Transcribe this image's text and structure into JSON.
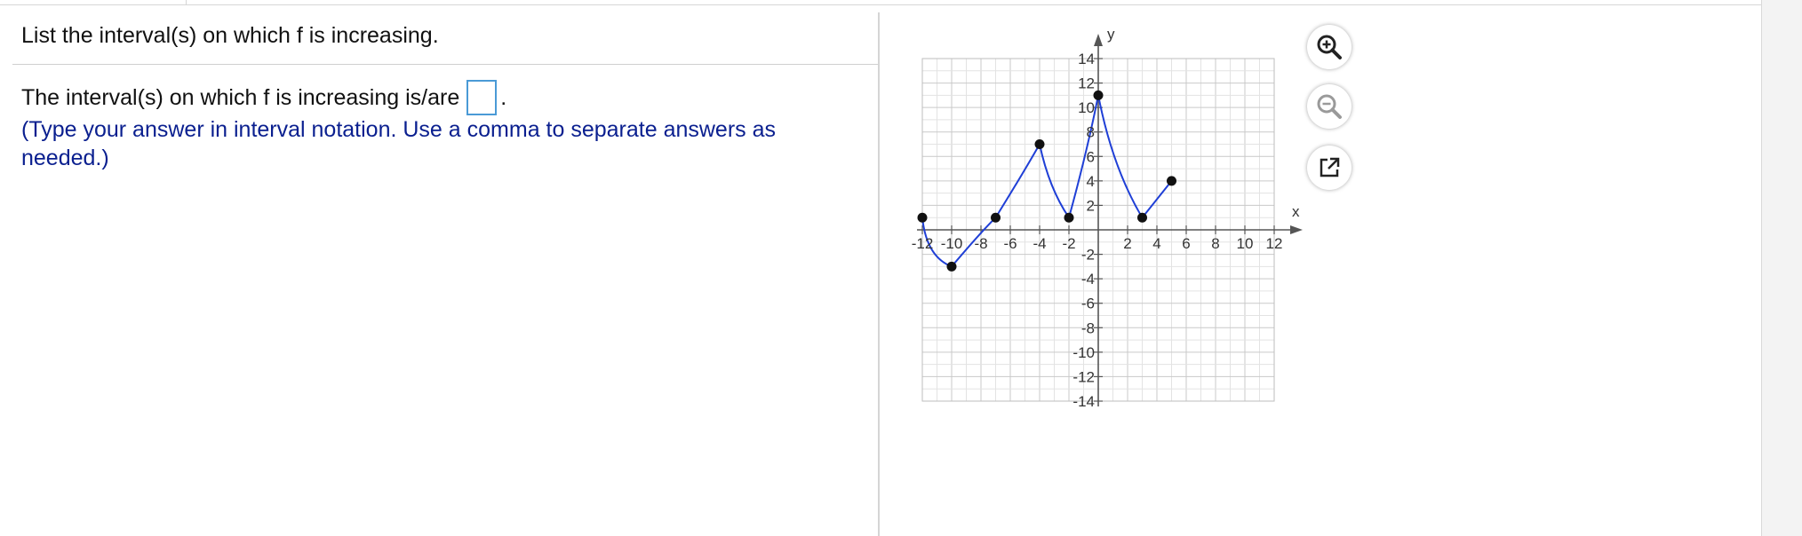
{
  "question": {
    "prompt": "List the interval(s) on which f is increasing."
  },
  "answer": {
    "lead_text": "The interval(s) on which f is increasing is/are",
    "trailing_period": ".",
    "input_value": "",
    "instruction": "(Type your answer in interval notation. Use a comma to separate answers as needed.)"
  },
  "colors": {
    "instruction_text": "#0a1f8f",
    "curve": "#1f3fd6",
    "point": "#111111",
    "input_border": "#4a9ad6"
  },
  "toolbar": {
    "zoom_in_icon": "zoom-in-icon",
    "zoom_out_icon": "zoom-out-icon",
    "popout_icon": "popout-icon"
  },
  "chart_data": {
    "type": "line",
    "xlabel": "x",
    "ylabel": "y",
    "xlim": [
      -12,
      12
    ],
    "ylim": [
      -14,
      14
    ],
    "grid": true,
    "x_ticks": [
      "-12",
      "-10",
      "-8",
      "-6",
      "-4",
      "-2",
      "2",
      "4",
      "6",
      "8",
      "10",
      "12"
    ],
    "y_ticks": [
      "14",
      "12",
      "10",
      "8",
      "6",
      "4",
      "2",
      "-2",
      "-4",
      "-6",
      "-8",
      "-10",
      "-12",
      "-14"
    ],
    "series": [
      {
        "points": [
          [
            -12,
            1
          ],
          [
            -10,
            -3
          ],
          [
            -7,
            1
          ],
          [
            -4,
            7
          ],
          [
            -2,
            1
          ],
          [
            0,
            11
          ],
          [
            3,
            1
          ],
          [
            5,
            4
          ]
        ]
      }
    ]
  }
}
